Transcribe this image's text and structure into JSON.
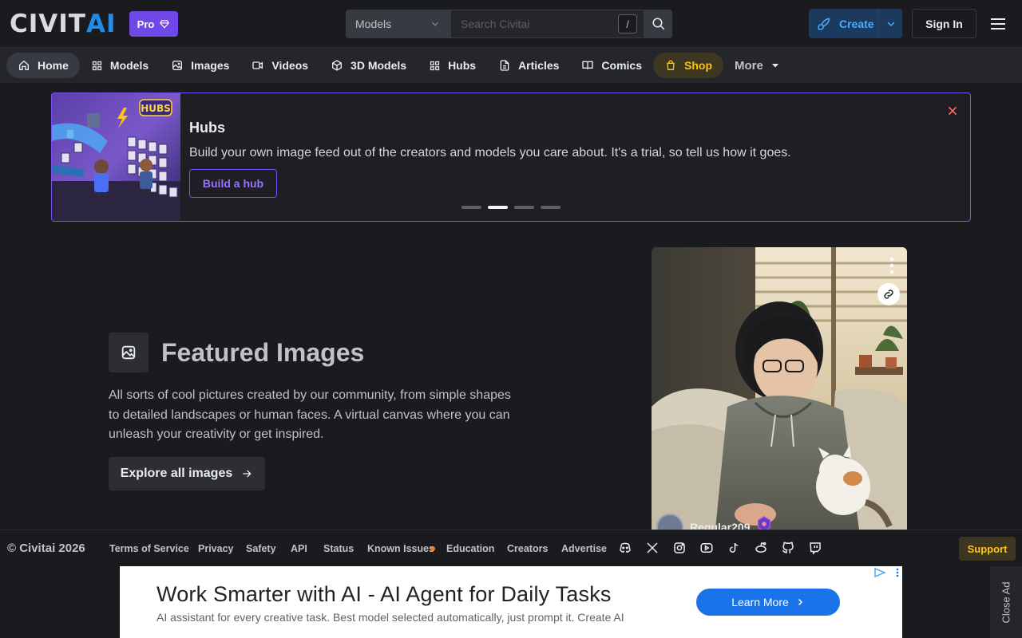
{
  "header": {
    "logo_civit": "CIVIT",
    "logo_ai": "AI",
    "pro_label": "Pro",
    "search_category": "Models",
    "search_placeholder": "Search Civitai",
    "search_shortcut": "/",
    "create_label": "Create",
    "signin_label": "Sign In"
  },
  "nav": {
    "items": [
      {
        "label": "Home",
        "icon": "home-icon",
        "active": true
      },
      {
        "label": "Models",
        "icon": "grid-icon"
      },
      {
        "label": "Images",
        "icon": "photo-icon"
      },
      {
        "label": "Videos",
        "icon": "video-icon"
      },
      {
        "label": "3D Models",
        "icon": "cube-icon"
      },
      {
        "label": "Hubs",
        "icon": "grid-icon"
      },
      {
        "label": "Articles",
        "icon": "file-text-icon"
      },
      {
        "label": "Comics",
        "icon": "book-icon"
      },
      {
        "label": "Shop",
        "icon": "shopping-bag-icon"
      },
      {
        "label": "More",
        "icon": "caret-down-icon"
      }
    ]
  },
  "banner": {
    "title": "Hubs",
    "description": "Build your own image feed out of the creators and models you care about. It's a trial, so tell us how it goes.",
    "button_label": "Build a hub",
    "image_label": "HUBS",
    "slides_total": 4,
    "active_slide": 2
  },
  "featured": {
    "title": "Featured Images",
    "description": "All sorts of cool pictures created by our community, from simple shapes to detailed landscapes or human faces. A virtual canvas where you can unleash your creativity or get inspired.",
    "button_label": "Explore all images",
    "card_username": "Regular209"
  },
  "footer": {
    "copyright": "© Civitai 2026",
    "links": [
      "Terms of Service",
      "Privacy",
      "Safety",
      "API",
      "Status",
      "Known Issues",
      "Education",
      "Creators",
      "Advertise"
    ],
    "social_icons": [
      "discord-icon",
      "x-icon",
      "instagram-icon",
      "youtube-icon",
      "tiktok-icon",
      "reddit-icon",
      "github-icon",
      "twitch-icon"
    ],
    "support_label": "Support"
  },
  "ad": {
    "title": "Work Smarter with AI - AI Agent for Daily Tasks",
    "subtitle": "AI assistant for every creative task. Best model selected automatically, just prompt it. Create AI",
    "button_label": "Learn More",
    "close_label": "Close Ad"
  },
  "colors": {
    "accent": "#228be6",
    "pro": "#7048e8",
    "banner_border": "#7950f2",
    "shop": "#fcc419",
    "ad_button": "#1a73e8"
  }
}
